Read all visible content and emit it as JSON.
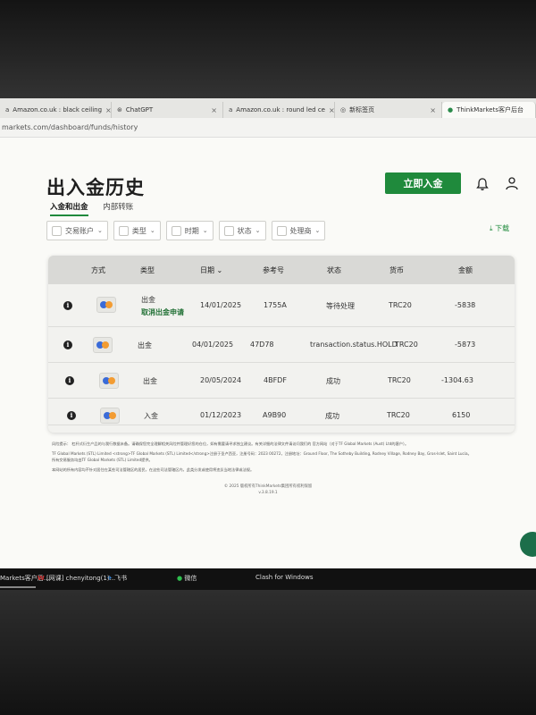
{
  "browser": {
    "tabs": [
      {
        "label": "Amazon.co.uk : black ceiling",
        "icon": "amazon-icon"
      },
      {
        "label": "ChatGPT",
        "icon": "chatgpt-icon"
      },
      {
        "label": "Amazon.co.uk : round led ce",
        "icon": "amazon-icon"
      },
      {
        "label": "新标签页",
        "icon": "chrome-icon"
      },
      {
        "label": "ThinkMarkets客户后台",
        "icon": "thinkmarkets-icon"
      }
    ],
    "url": "markets.com/dashboard/funds/history"
  },
  "page": {
    "title": "出入金历史",
    "deposit_button": "立即入金",
    "subtabs": [
      "入金和出金",
      "内部转账"
    ],
    "filters": [
      "交易账户",
      "类型",
      "时期",
      "状态",
      "处理商"
    ],
    "download": "下载"
  },
  "table": {
    "headers": [
      "方式",
      "类型",
      "日期",
      "参考号",
      "状态",
      "货币",
      "金额"
    ],
    "rows": [
      {
        "type": "出金",
        "action": "取消出金申请",
        "date": "14/01/2025",
        "ref": "1755A",
        "status": "等待处理",
        "currency": "TRC20",
        "amount": "-5838"
      },
      {
        "type": "出金",
        "action": "",
        "date": "04/01/2025",
        "ref": "47D78",
        "status": "transaction.status.HOLD",
        "currency": "TRC20",
        "amount": "-5873"
      },
      {
        "type": "出金",
        "action": "",
        "date": "20/05/2024",
        "ref": "4BFDF",
        "status": "成功",
        "currency": "TRC20",
        "amount": "-1304.63"
      },
      {
        "type": "入金",
        "action": "",
        "date": "01/12/2023",
        "ref": "A9B90",
        "status": "成功",
        "currency": "TRC20",
        "amount": "6150"
      }
    ]
  },
  "footer": {
    "risk": "风险提示：   杠杆式衍生产品的与我行数据未备。请确保您完全理解相关风险并管理好您的仓位，如有需要请寻求独立建议。有关详细的法律文件请访问我们的 官方网站（对于TF Global Markets (Aust) Ltd的客户）。",
    "entity": "TF Global Markets (STL) Limited <strong>TF Global Markets (STL) Limited</strong>注册于圣卢西亚，注册号码：2023 00272，注册地址：Ground Floor, The Sotheby Building, Rodney Village, Rodney Bay, Gros-Islet, Saint Lucia。所有交易服务均由TF Global Markets (STL) Limited提供。",
    "note": "本网站的所有内容均不针对居住在某些司法管辖区的居民，在这些司法管辖区内，此类分发或使用将违反当地法律或法规。",
    "copyright": "© 2025 版权所有ThinkMarkets集团所有权利保留",
    "version": "v.3.8.19.1"
  },
  "taskbar": {
    "items": [
      "Markets客户后...",
      "[网课] chenyitong(1)...",
      "飞书",
      "微信",
      "Clash for Windows"
    ]
  },
  "colors": {
    "accent": "#1f8a3c",
    "link": "#1f6f33"
  }
}
